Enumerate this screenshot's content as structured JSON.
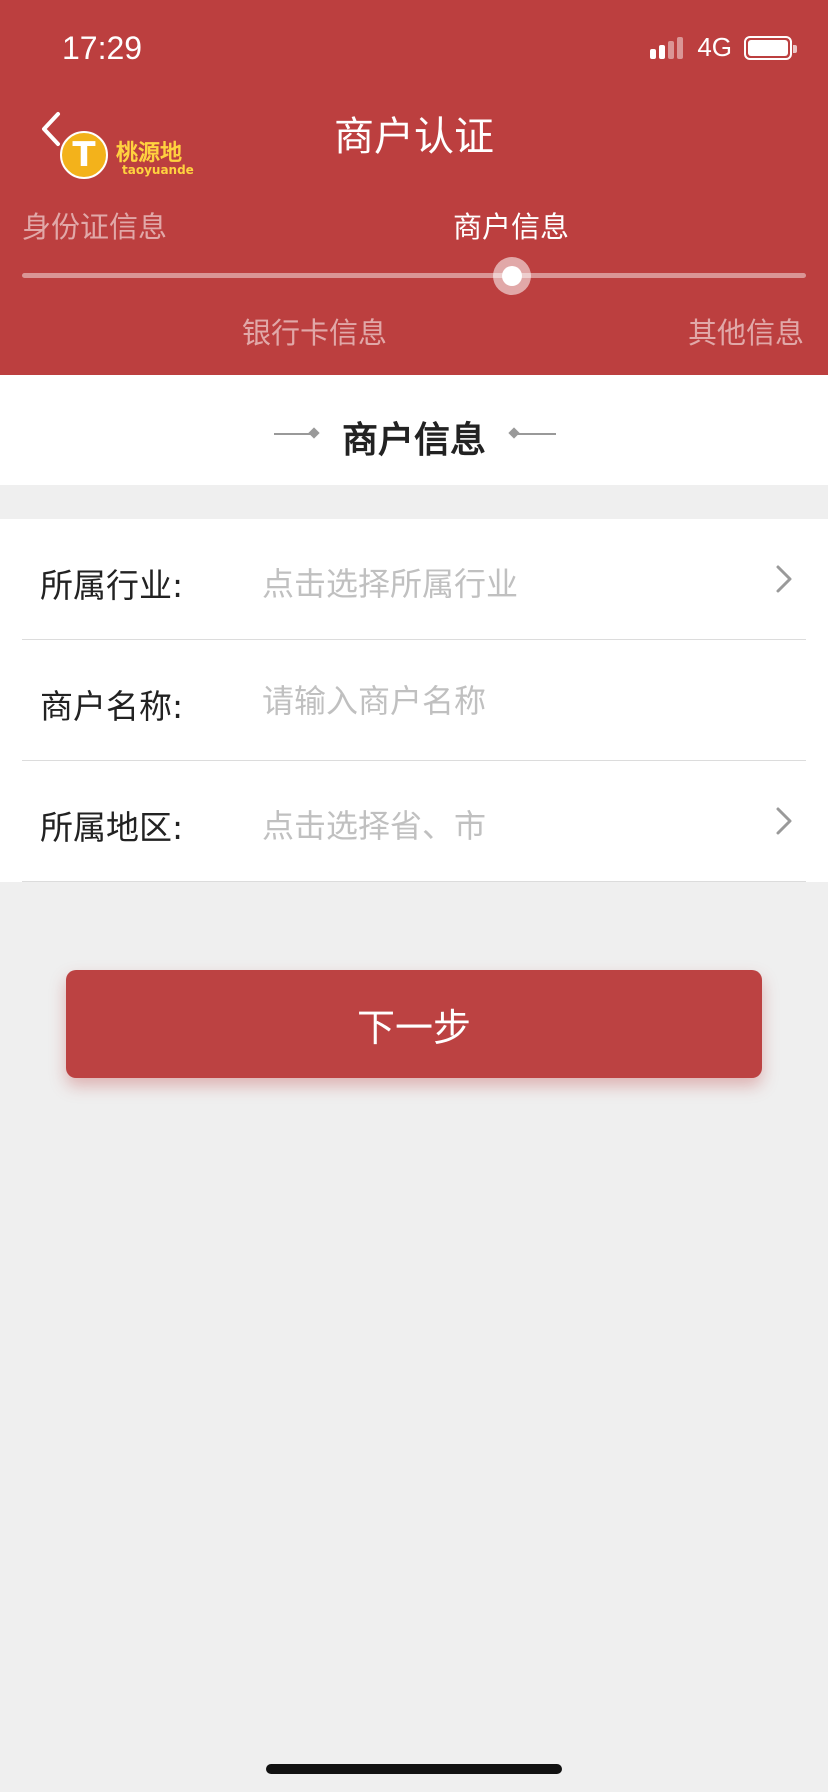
{
  "status_bar": {
    "time": "17:29",
    "network": "4G"
  },
  "header": {
    "title": "商户认证",
    "logo_text": "桃源地",
    "logo_subtext": "taoyuande",
    "logo_letter": "T"
  },
  "steps": {
    "items": [
      {
        "label": "身份证信息"
      },
      {
        "label": "商户信息"
      },
      {
        "label": "银行卡信息"
      },
      {
        "label": "其他信息"
      }
    ],
    "active_index": 1
  },
  "section": {
    "title": "商户信息"
  },
  "form": {
    "fields": [
      {
        "label": "所属行业:",
        "placeholder": "点击选择所属行业",
        "type": "select"
      },
      {
        "label": "商户名称:",
        "placeholder": "请输入商户名称",
        "type": "text"
      },
      {
        "label": "所属地区:",
        "placeholder": "点击选择省、市",
        "type": "select"
      }
    ]
  },
  "next_button": {
    "label": "下一步"
  },
  "colors": {
    "primary": "#bc3f3f",
    "background": "#efefef",
    "logo_gold": "#f3b21b"
  }
}
